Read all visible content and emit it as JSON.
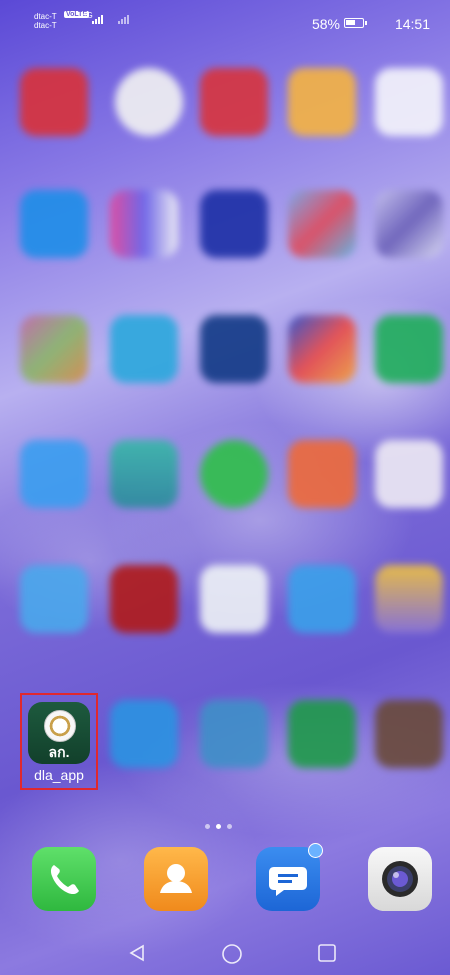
{
  "status_bar": {
    "carrier_line1": "dtac-T",
    "carrier_line2": "dtac-T",
    "volte": "VoLTE",
    "network": "4G",
    "battery_percent": "58%",
    "time": "14:51"
  },
  "highlighted_app": {
    "icon_text": "ลก.",
    "label": "dla_app"
  },
  "dock": {
    "items": [
      "phone",
      "contacts",
      "messages",
      "camera"
    ]
  },
  "nav": {
    "back": "back",
    "home": "home",
    "recents": "recents"
  },
  "colors": {
    "highlight_border": "#e0282e",
    "dla_icon_bg": "#1d5a3e"
  }
}
